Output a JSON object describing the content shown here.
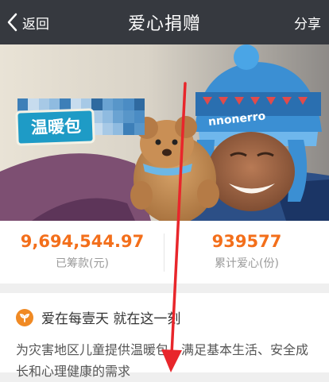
{
  "nav": {
    "back_label": "返回",
    "title": "爱心捐赠",
    "share_label": "分享"
  },
  "banner": {
    "tag_label": "温暖包",
    "hat_text": "nnonerro"
  },
  "stats": {
    "raised_amount": "9,694,544.97",
    "raised_label": "已筹款(元)",
    "donors_count": "939577",
    "donors_label": "累计爱心(份)"
  },
  "description": {
    "title": "爱在每壹天 就在这一刻",
    "body": "为灾害地区儿童提供温暖包，满足基本生活、安全成长和心理健康的需求"
  },
  "colors": {
    "navbar": "#36393f",
    "accent_orange": "#f36f1b",
    "annotation_red": "#e8262b",
    "tag_blue": "#1e9bc6"
  },
  "icons": [
    "back-chevron-icon",
    "leaf-icon",
    "annotation-arrow-icon"
  ]
}
